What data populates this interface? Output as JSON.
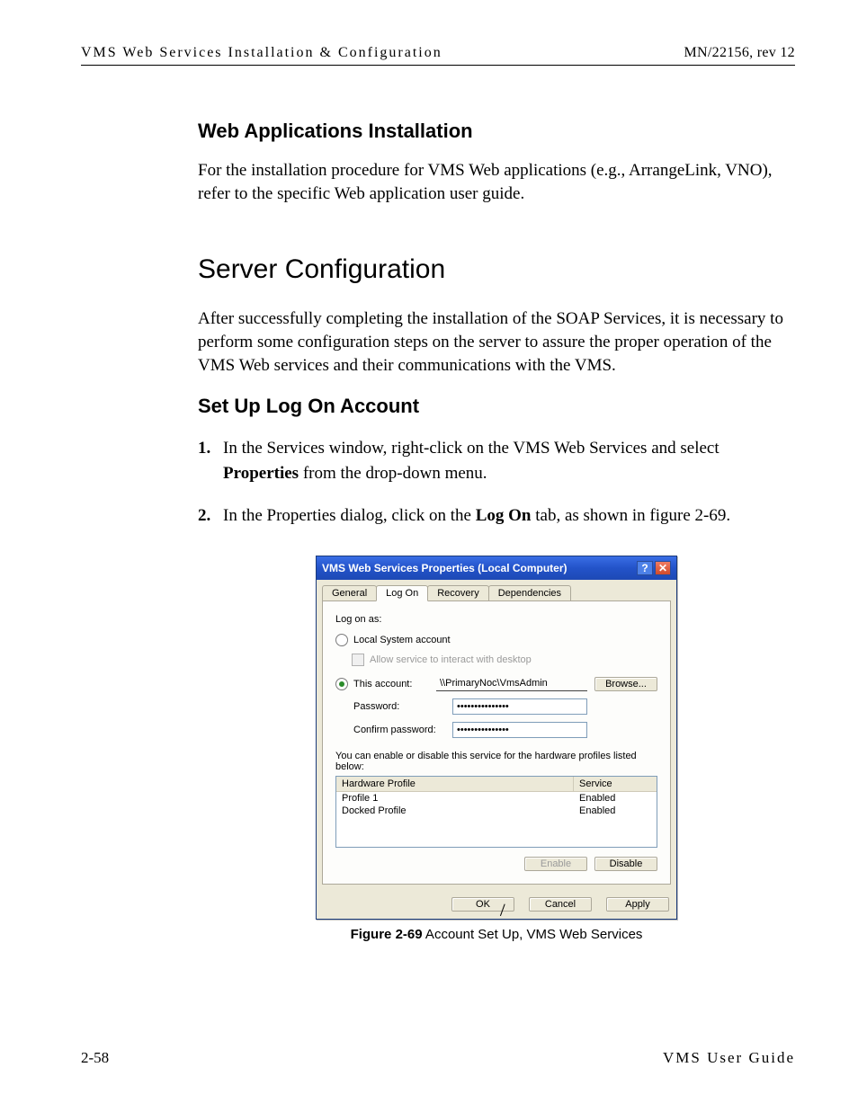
{
  "header": {
    "left": "VMS Web Services Installation & Configuration",
    "right": "MN/22156, rev 12"
  },
  "sections": {
    "webapps_title": "Web Applications Installation",
    "webapps_para": "For the installation procedure for VMS Web applications (e.g., ArrangeLink, VNO), refer to the specific Web application user guide.",
    "server_title": "Server Configuration",
    "server_para": "After successfully completing the installation of the SOAP Services, it is necessary to perform some configuration steps on the server to assure the proper operation of the VMS Web services and their communications with the VMS.",
    "logon_title": "Set Up Log On Account"
  },
  "steps": {
    "s1_num": "1.",
    "s1_a": "In the Services window, right-click on the VMS Web Services and select ",
    "s1_b": "Properties",
    "s1_c": " from the drop-down menu.",
    "s2_num": "2.",
    "s2_a": "In the Properties dialog, click on the ",
    "s2_b": "Log On",
    "s2_c": " tab, as shown in figure 2-69."
  },
  "dialog": {
    "title": "VMS Web Services Properties (Local Computer)",
    "tabs": {
      "general": "General",
      "logon": "Log On",
      "recovery": "Recovery",
      "deps": "Dependencies"
    },
    "logon_as": "Log on as:",
    "local_system": "Local System account",
    "allow_interact": "Allow service to interact with desktop",
    "this_account": "This account:",
    "account_value": "\\\\PrimaryNoc\\VmsAdmin",
    "browse": "Browse...",
    "password_label": "Password:",
    "confirm_label": "Confirm password:",
    "pw_mask": "•••••••••••••••",
    "profiles_text": "You can enable or disable this service for the hardware profiles listed below:",
    "col_profile": "Hardware Profile",
    "col_service": "Service",
    "rows": [
      {
        "name": "Profile 1",
        "status": "Enabled"
      },
      {
        "name": "Docked Profile",
        "status": "Enabled"
      }
    ],
    "enable": "Enable",
    "disable": "Disable",
    "ok": "OK",
    "cancel": "Cancel",
    "apply": "Apply"
  },
  "caption": {
    "label": "Figure 2-69",
    "text": "   Account Set Up, VMS Web Services"
  },
  "footer": {
    "left": "2-58",
    "right": "VMS User Guide"
  }
}
